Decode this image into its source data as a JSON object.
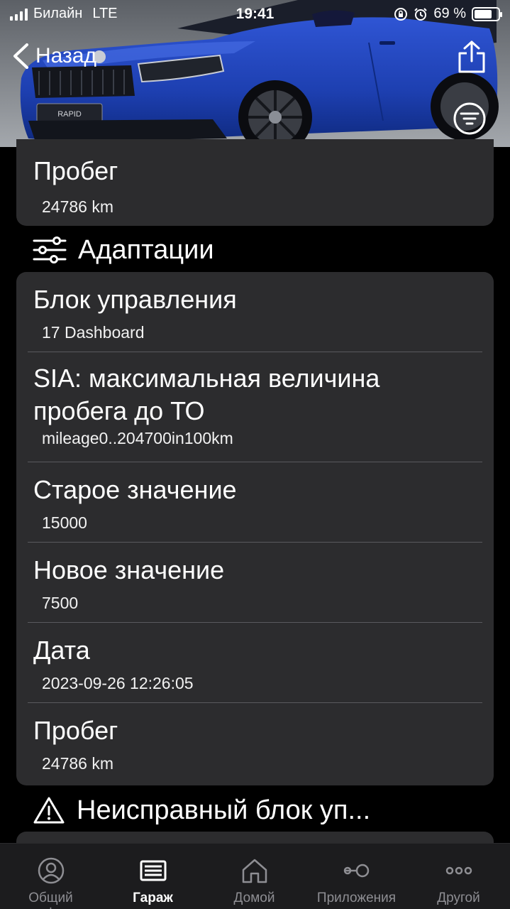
{
  "status_bar": {
    "carrier": "Билайн",
    "network": "LTE",
    "time": "19:41",
    "battery": "69 %"
  },
  "nav": {
    "back_label": "Назад"
  },
  "top_card": {
    "title": "Пробег",
    "value": "24786 km"
  },
  "adaptations": {
    "header": "Адаптации",
    "rows": [
      {
        "title": "Блок управления",
        "value": "17 Dashboard"
      },
      {
        "title": "SIA: максимальная величина пробега до ТО",
        "value": "mileage0..204700in100km"
      },
      {
        "title": "Старое значение",
        "value": "15000"
      },
      {
        "title": "Новое значение",
        "value": "7500"
      },
      {
        "title": "Дата",
        "value": "2023-09-26 12:26:05"
      },
      {
        "title": "Пробег",
        "value": "24786 km"
      }
    ]
  },
  "faulty_section": {
    "header": "Неисправный блок уп..."
  },
  "tabs": [
    {
      "label": "Общий профиль",
      "icon": "person-circle-icon",
      "active": false
    },
    {
      "label": "Гараж",
      "icon": "garage-icon",
      "active": true
    },
    {
      "label": "Домой",
      "icon": "home-icon",
      "active": false
    },
    {
      "label": "Приложения",
      "icon": "toggle-icon",
      "active": false
    },
    {
      "label": "Другой",
      "icon": "more-icon",
      "active": false
    }
  ],
  "car_badge": "RAPID",
  "colors": {
    "card_bg": "#2c2c2e",
    "tabbar_bg": "#1c1c1e",
    "car_blue": "#1d3fb0"
  }
}
